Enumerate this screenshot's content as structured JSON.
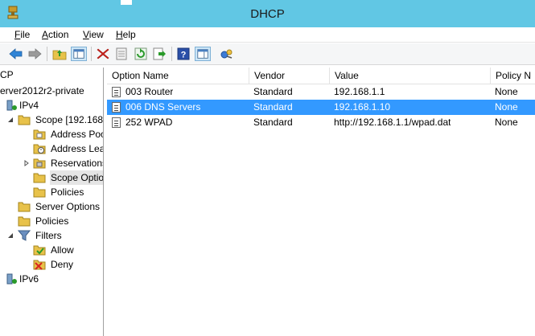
{
  "window": {
    "title": "DHCP"
  },
  "menu": [
    {
      "key": "F",
      "rest": "ile"
    },
    {
      "key": "A",
      "rest": "ction"
    },
    {
      "key": "V",
      "rest": "iew"
    },
    {
      "key": "H",
      "rest": "elp"
    }
  ],
  "toolbar": {
    "icons": [
      "back-arrow-icon",
      "forward-arrow-icon",
      "up-folder-icon",
      "show-hide-tree-icon",
      "delete-icon",
      "properties-icon",
      "refresh-icon",
      "export-list-icon",
      "help-icon",
      "show-hide-action-pane-icon",
      "dhcp-options-icon"
    ]
  },
  "tree": {
    "items": [
      {
        "label": "CP"
      },
      {
        "label": "erver2012r2-private"
      },
      {
        "label": "IPv4"
      },
      {
        "label": "Scope [192.168.1"
      },
      {
        "label": "Address Poo"
      },
      {
        "label": "Address Leas"
      },
      {
        "label": "Reservations"
      },
      {
        "label": "Scope Optio"
      },
      {
        "label": "Policies"
      },
      {
        "label": "Server Options"
      },
      {
        "label": "Policies"
      },
      {
        "label": "Filters"
      },
      {
        "label": "Allow"
      },
      {
        "label": "Deny"
      },
      {
        "label": "IPv6"
      }
    ]
  },
  "list": {
    "columns": [
      "Option Name",
      "Vendor",
      "Value",
      "Policy N"
    ],
    "rows": [
      {
        "name": "003 Router",
        "vendor": "Standard",
        "value": "192.168.1.1",
        "policy": "None"
      },
      {
        "name": "006 DNS Servers",
        "vendor": "Standard",
        "value": "192.168.1.10",
        "policy": "None"
      },
      {
        "name": "252 WPAD",
        "vendor": "Standard",
        "value": "http://192.168.1.1/wpad.dat",
        "policy": "None"
      }
    ],
    "selected_row": 1
  },
  "colors": {
    "titlebar": "#61c7e4",
    "selection": "#3399ff"
  }
}
